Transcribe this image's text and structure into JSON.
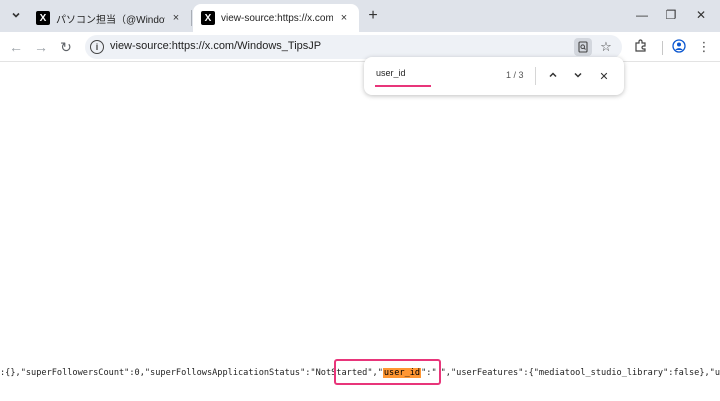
{
  "tabs": [
    {
      "favicon": "X",
      "title": "パソコン担当（@Windows_TipsJ",
      "active": false
    },
    {
      "favicon": "X",
      "title": "view-source:https://x.com/Wind",
      "active": true
    }
  ],
  "icons": {
    "tab_list": "chevron-down-icon",
    "tab_close": "×",
    "new_tab": "+",
    "minimize": "—",
    "maximize": "❐",
    "close": "✕",
    "back": "←",
    "forward": "→",
    "reload": "↻",
    "site_info": "i",
    "find_in_page": "page-search-icon",
    "bookmark": "☆",
    "extensions": "puzzle-icon",
    "profile": "user-circle-icon",
    "menu": "⋮",
    "find_prev": "chevron-up-icon",
    "find_next": "chevron-down-icon",
    "find_close": "✕"
  },
  "omnibox": {
    "url": "view-source:https://x.com/Windows_TipsJP"
  },
  "findbar": {
    "query": "user_id",
    "count": "1 / 3"
  },
  "source": {
    "before": ":{},\"superFollowersCount\":0,\"superFollowsApplicationStatus\":\"NotStarted\",\"",
    "match": "user_id",
    "middle": "\":\"",
    "after": "\",\"userFeatures\":{\"mediatool_studio_library\":false},\"upsells\""
  },
  "colors": {
    "accent": "#e8357a",
    "match_highlight": "#ff9632",
    "tabstrip": "#dfe3ea"
  }
}
